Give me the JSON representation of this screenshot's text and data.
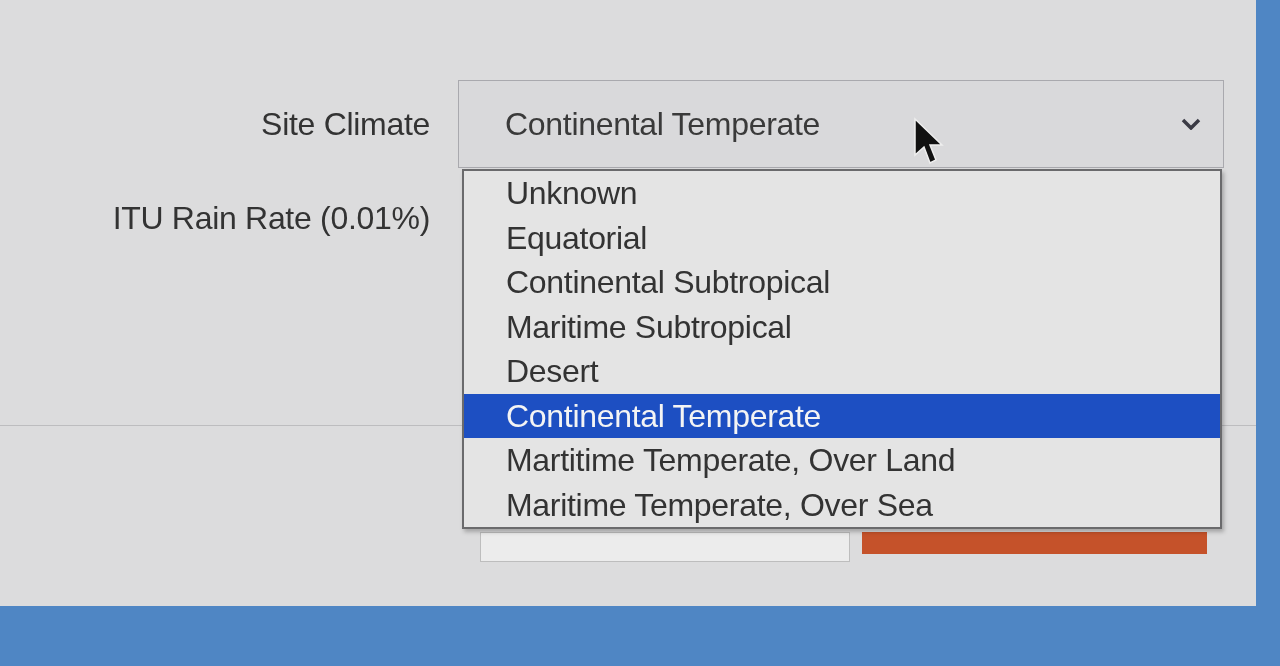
{
  "form": {
    "fields": [
      {
        "label": "Site Climate",
        "value": "Continental Temperate",
        "expanded": true
      },
      {
        "label": "ITU Rain Rate (0.01%)"
      }
    ]
  },
  "dropdown": {
    "options": [
      {
        "label": "Unknown",
        "selected": false
      },
      {
        "label": "Equatorial",
        "selected": false
      },
      {
        "label": "Continental Subtropical",
        "selected": false
      },
      {
        "label": "Maritime Subtropical",
        "selected": false
      },
      {
        "label": "Desert",
        "selected": false
      },
      {
        "label": "Continental Temperate",
        "selected": true
      },
      {
        "label": "Martitime Temperate, Over Land",
        "selected": false
      },
      {
        "label": "Maritime Temperate, Over Sea",
        "selected": false
      }
    ]
  }
}
